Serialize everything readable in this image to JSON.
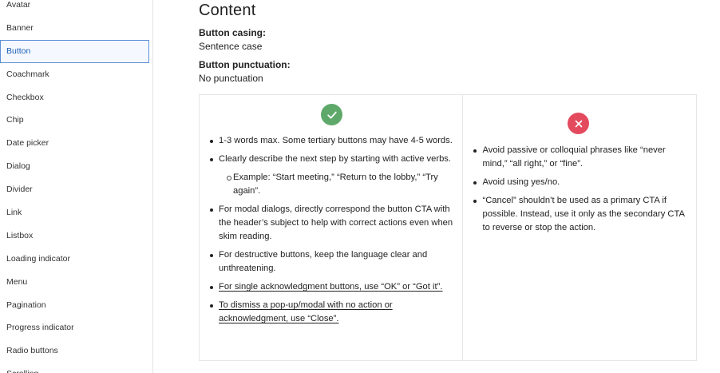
{
  "sidebar": {
    "items": [
      {
        "label": "Avatar"
      },
      {
        "label": "Banner"
      },
      {
        "label": "Button"
      },
      {
        "label": "Coachmark"
      },
      {
        "label": "Checkbox"
      },
      {
        "label": "Chip"
      },
      {
        "label": "Date picker"
      },
      {
        "label": "Dialog"
      },
      {
        "label": "Divider"
      },
      {
        "label": "Link"
      },
      {
        "label": "Listbox"
      },
      {
        "label": "Loading indicator"
      },
      {
        "label": "Menu"
      },
      {
        "label": "Pagination"
      },
      {
        "label": "Progress indicator"
      },
      {
        "label": "Radio buttons"
      },
      {
        "label": "Scrolling"
      }
    ],
    "active_index": 2
  },
  "main": {
    "title": "Content",
    "casing_label": "Button casing:",
    "casing_value": "Sentence case",
    "punctuation_label": "Button punctuation:",
    "punctuation_value": "No punctuation",
    "do": {
      "icon": "checkmark-icon",
      "color": "#5ea96a",
      "items": [
        "1-3 words max. Some tertiary buttons may have 4-5 words.",
        "Clearly describe the next step by starting with active verbs.",
        "For modal dialogs, directly correspond the button CTA with the header’s subject to help with correct actions even when skim reading.",
        "For destructive buttons, keep the language clear and unthreatening.",
        "For single acknowledgment buttons, use “OK” or “Got it”.",
        "To dismiss a pop-up/modal with no action or acknowledgment, use “Close”."
      ],
      "example": "Example: “Start meeting,” “Return to the lobby,” “Try again”."
    },
    "dont": {
      "icon": "x-icon",
      "color": "#e34a5e",
      "items": [
        "Avoid passive or colloquial phrases like “never mind,” “all right,” or “fine”.",
        "Avoid using yes/no.",
        "“Cancel” shouldn’t be used as a primary CTA if possible. Instead, use it only as the secondary CTA to reverse or stop the action."
      ]
    }
  }
}
